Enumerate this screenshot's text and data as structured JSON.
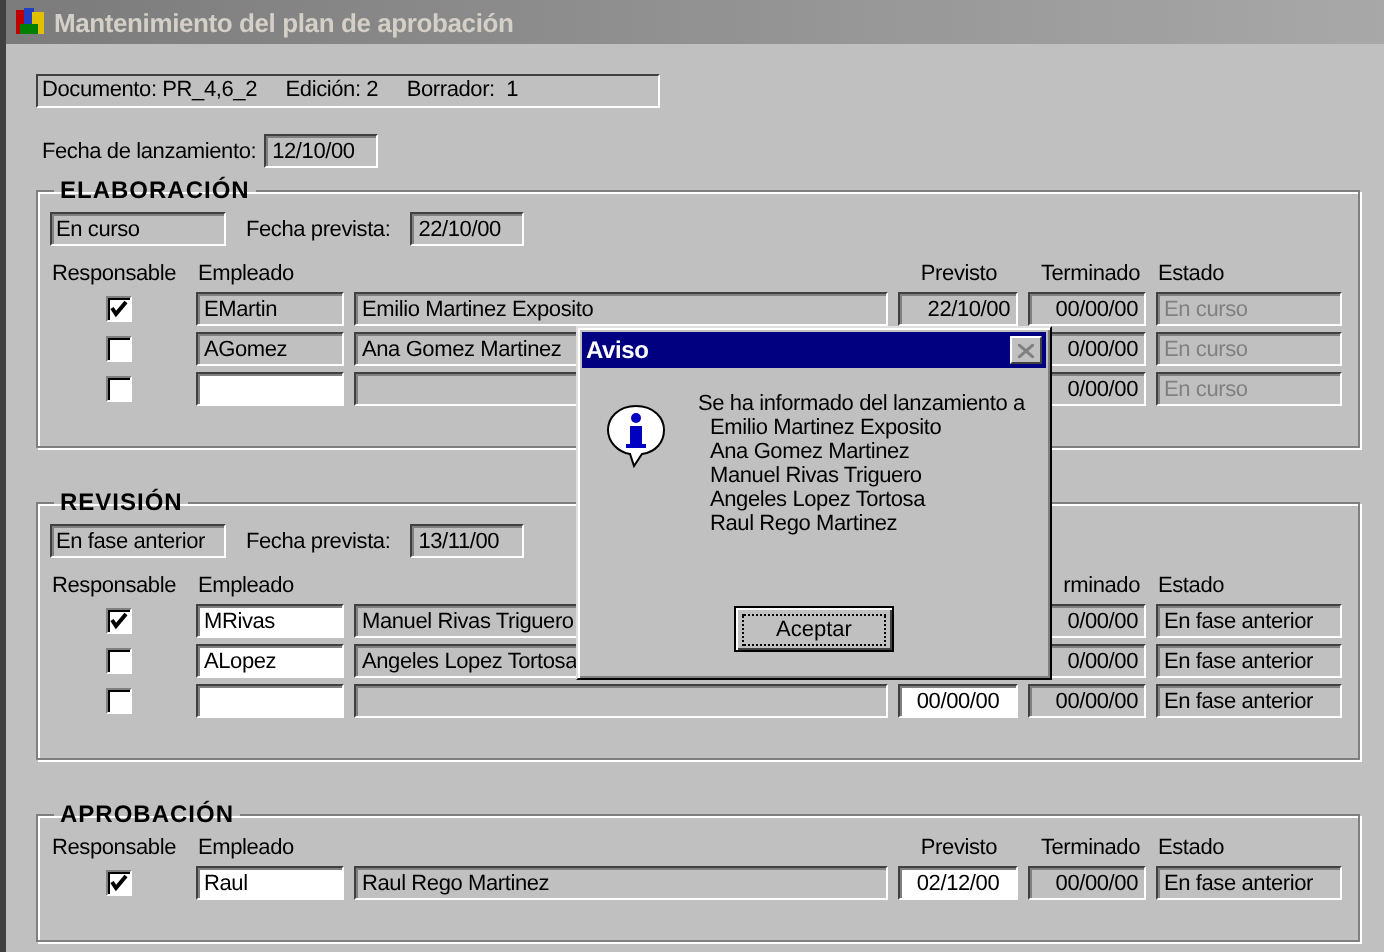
{
  "window": {
    "title": "Mantenimiento del plan de aprobación"
  },
  "document": {
    "text": "Documento: PR_4,6_2     Edición: 2     Borrador:  1"
  },
  "launch": {
    "label": "Fecha de lanzamiento:",
    "date": "12/10/00"
  },
  "sections": [
    {
      "title": "ELABORACIÓN",
      "status": "En curso",
      "planned_label": "Fecha prevista:",
      "planned_date": "22/10/00",
      "headers": [
        {
          "kind": "responsible",
          "label": "Responsable"
        },
        {
          "kind": "employee",
          "label": "Empleado"
        },
        {
          "kind": "planned",
          "label": "Previsto"
        },
        {
          "kind": "finished",
          "label": "Terminado"
        },
        {
          "kind": "state",
          "label": "Estado"
        }
      ],
      "rows": [
        {
          "responsible": true,
          "code": "EMartin",
          "code_editable": false,
          "name": "Emilio Martinez Exposito",
          "planned": "22/10/00",
          "planned_editable": false,
          "finished": "00/00/00",
          "state": "En curso",
          "state_disabled": true
        },
        {
          "responsible": false,
          "code": "AGomez",
          "code_editable": false,
          "name": "Ana Gomez Martinez",
          "finished": "0/00/00",
          "state": "En curso",
          "state_disabled": true
        },
        {
          "responsible": false,
          "code_editable": true,
          "finished": "0/00/00",
          "state": "En curso",
          "state_disabled": true
        }
      ]
    },
    {
      "title": "REVISIÓN",
      "status": "En fase anterior",
      "planned_label": "Fecha prevista:",
      "planned_date": "13/11/00",
      "headers": [
        {
          "kind": "responsible",
          "label": "Responsable"
        },
        {
          "kind": "employee",
          "label": "Empleado"
        },
        {
          "kind": "finished",
          "label": "rminado"
        },
        {
          "kind": "state",
          "label": "Estado"
        }
      ],
      "rows": [
        {
          "responsible": true,
          "code": "MRivas",
          "code_editable": true,
          "name": "Manuel Rivas Triguero",
          "finished": "0/00/00",
          "state": "En fase anterior",
          "state_disabled": false
        },
        {
          "responsible": false,
          "code": "ALopez",
          "code_editable": true,
          "name": "Angeles Lopez Tortosa",
          "finished": "0/00/00",
          "state": "En fase anterior",
          "state_disabled": false
        },
        {
          "responsible": false,
          "code_editable": true,
          "planned": "00/00/00",
          "planned_editable": true,
          "finished": "00/00/00",
          "state": "En fase anterior",
          "state_disabled": false
        }
      ]
    },
    {
      "title": "APROBACIÓN",
      "headers": [
        {
          "kind": "responsible",
          "label": "Responsable"
        },
        {
          "kind": "employee",
          "label": "Empleado"
        },
        {
          "kind": "planned",
          "label": "Previsto"
        },
        {
          "kind": "finished",
          "label": "Terminado"
        },
        {
          "kind": "state",
          "label": "Estado"
        }
      ],
      "rows": [
        {
          "responsible": true,
          "code": "Raul",
          "code_editable": true,
          "name": "Raul Rego Martinez",
          "planned": "02/12/00",
          "planned_editable": true,
          "finished": "00/00/00",
          "state": "En fase anterior",
          "state_disabled": false
        }
      ]
    }
  ],
  "dialog": {
    "title": "Aviso",
    "message": "Se ha informado del lanzamiento a",
    "names": [
      "Emilio Martinez Exposito",
      "Ana Gomez Martinez",
      "Manuel Rivas Triguero",
      "Angeles Lopez Tortosa",
      "Raul Rego Martinez"
    ],
    "button": "Aceptar"
  }
}
